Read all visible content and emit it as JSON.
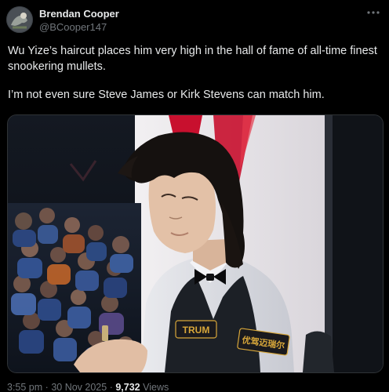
{
  "tweet": {
    "author": {
      "display_name": "Brendan Cooper",
      "handle": "@BCooper147"
    },
    "text_lines": [
      "Wu Yize’s haircut places him very high in the hall of fame of all-time finest snookering mullets.",
      "I’m not even sure Steve James or Kirk Stevens can match him."
    ],
    "media": {
      "type": "photo",
      "waistcoat_badges": [
        "TRUM",
        "优驾迈瑞尔"
      ]
    },
    "meta": {
      "time": "3:55 pm",
      "separator": "·",
      "date": "30 Nov 2025",
      "views_count": "9,732",
      "views_label": "Views"
    }
  },
  "icons": {
    "more": "more-horizontal-icon",
    "avatar": "avatar"
  },
  "colors": {
    "background": "#000000",
    "text_primary": "#e7e9ea",
    "text_secondary": "#71767b",
    "border": "#2f3336",
    "badge_gold": "#d8a73a",
    "backdrop_red": "#c8102e"
  }
}
